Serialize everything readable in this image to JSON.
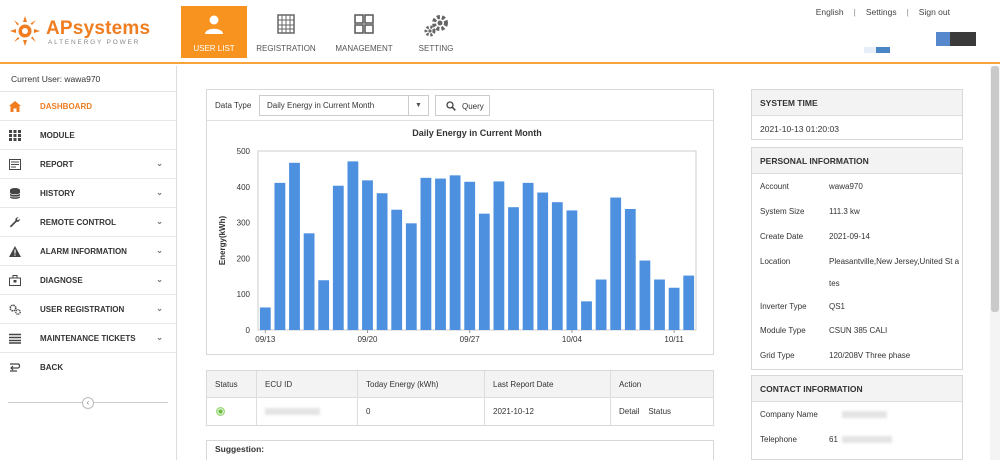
{
  "brand": {
    "name_ap": "AP",
    "name_sys": "systems",
    "tagline": "ALTENERGY POWER"
  },
  "nav": [
    {
      "label": "USER LIST",
      "icon": "user-icon",
      "active": true
    },
    {
      "label": "REGISTRATION",
      "icon": "registration-grid-icon",
      "active": false
    },
    {
      "label": "MANAGEMENT",
      "icon": "management-squares-icon",
      "active": false
    },
    {
      "label": "SETTING",
      "icon": "gear-icon",
      "active": false
    }
  ],
  "toplinks": {
    "language": "English",
    "settings": "Settings",
    "signout": "Sign out",
    "sep": "|"
  },
  "sidebar": {
    "current_user": "Current User: wawa970",
    "items": [
      {
        "label": "DASHBOARD",
        "icon": "home-icon",
        "active": true,
        "chevron": false
      },
      {
        "label": "MODULE",
        "icon": "module-grid-icon",
        "active": false,
        "chevron": false
      },
      {
        "label": "REPORT",
        "icon": "report-icon",
        "active": false,
        "chevron": true
      },
      {
        "label": "HISTORY",
        "icon": "database-icon",
        "active": false,
        "chevron": true
      },
      {
        "label": "REMOTE CONTROL",
        "icon": "wrench-icon",
        "active": false,
        "chevron": true
      },
      {
        "label": "ALARM INFORMATION",
        "icon": "warning-icon",
        "active": false,
        "chevron": true
      },
      {
        "label": "DIAGNOSE",
        "icon": "toolbox-icon",
        "active": false,
        "chevron": true
      },
      {
        "label": "USER REGISTRATION",
        "icon": "gears-icon",
        "active": false,
        "chevron": true
      },
      {
        "label": "MAINTENANCE TICKETS",
        "icon": "list-icon",
        "active": false,
        "chevron": true
      },
      {
        "label": "BACK",
        "icon": "back-arrow-icon",
        "active": false,
        "chevron": false
      }
    ],
    "collapse_glyph": "‹",
    "chevron_glyph": "⌄"
  },
  "toolbar": {
    "data_type_label": "Data Type",
    "data_type_value": "Daily Energy in Current Month",
    "dropdown_glyph": "▼",
    "query_label": "Query"
  },
  "chart_data": {
    "type": "bar",
    "title": "Daily Energy in Current Month",
    "ylabel": "Energy(kWh)",
    "xlabel": "",
    "ylim": [
      0,
      500
    ],
    "yticks": [
      0,
      100,
      200,
      300,
      400,
      500
    ],
    "x_tick_labels": [
      "09/13",
      "09/20",
      "09/27",
      "10/04",
      "10/11"
    ],
    "x_tick_index": [
      0,
      7,
      14,
      21,
      28
    ],
    "categories": [
      "09/13",
      "09/14",
      "09/15",
      "09/16",
      "09/17",
      "09/18",
      "09/19",
      "09/20",
      "09/21",
      "09/22",
      "09/23",
      "09/24",
      "09/25",
      "09/26",
      "09/27",
      "09/28",
      "09/29",
      "09/30",
      "10/01",
      "10/02",
      "10/03",
      "10/04",
      "10/05",
      "10/06",
      "10/07",
      "10/08",
      "10/09",
      "10/10",
      "10/11",
      "10/12"
    ],
    "values": [
      63,
      411,
      467,
      270,
      139,
      403,
      471,
      418,
      382,
      336,
      298,
      425,
      423,
      432,
      414,
      325,
      415,
      343,
      411,
      384,
      357,
      334,
      80,
      141,
      370,
      338,
      194,
      141,
      118,
      152
    ],
    "color": "#4d90e0",
    "grid": false
  },
  "table": {
    "headers": [
      "Status",
      "ECU ID",
      "Today Energy (kWh)",
      "Last Report Date",
      "Action"
    ],
    "row": {
      "today_energy": "0",
      "last_report": "2021-10-12",
      "detail": "Detail",
      "status": "Status"
    }
  },
  "suggestion_label": "Suggestion:",
  "system_time": {
    "title": "SYSTEM TIME",
    "value": "2021-10-13 01:20:03"
  },
  "personal_info": {
    "title": "PERSONAL INFORMATION",
    "rows": [
      {
        "label": "Account",
        "value": "wawa970"
      },
      {
        "label": "System Size",
        "value": "111.3 kw"
      },
      {
        "label": "Create Date",
        "value": "2021-09-14"
      },
      {
        "label": "Location",
        "value": "Pleasantville,New Jersey,United St ates"
      },
      {
        "label": "Inverter Type",
        "value": "QS1"
      },
      {
        "label": "Module Type",
        "value": "CSUN 385 CALI"
      },
      {
        "label": "Grid Type",
        "value": "120/208V Three phase"
      }
    ]
  },
  "contact_info": {
    "title": "CONTACT INFORMATION",
    "rows": [
      {
        "label": "Company Name",
        "value": ""
      },
      {
        "label": "Telephone",
        "value": "61"
      }
    ]
  },
  "colors": {
    "accent": "#f7931e",
    "bar": "#4d90e0",
    "status_ok": "#6bbd3c"
  }
}
